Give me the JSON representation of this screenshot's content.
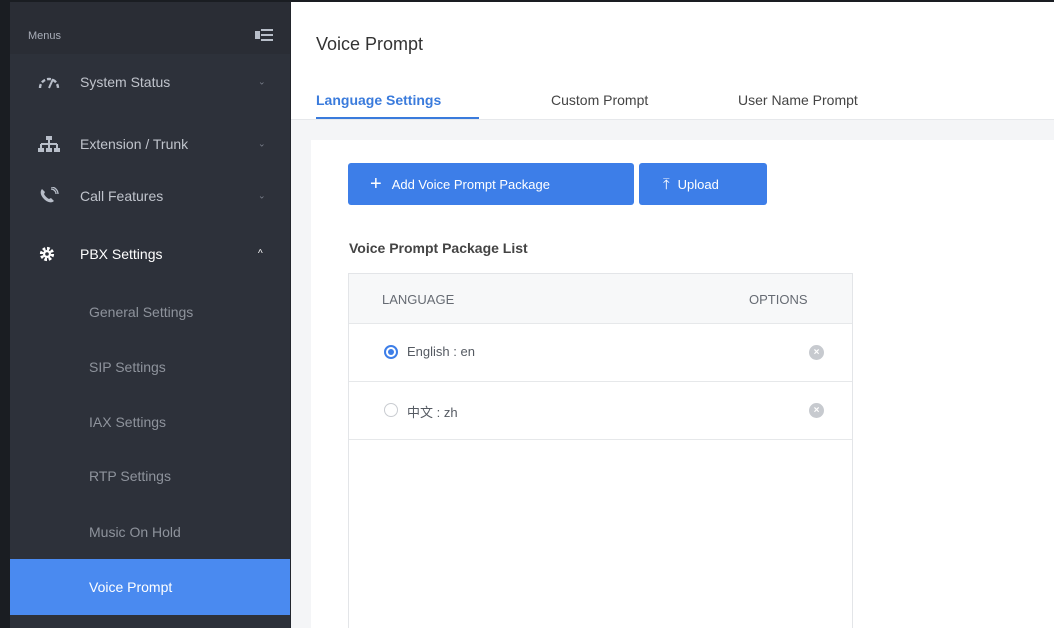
{
  "sidebar": {
    "menus_label": "Menus",
    "items": [
      {
        "label": "System Status",
        "icon": "gauge-icon",
        "chevron": "⌄"
      },
      {
        "label": "Extension / Trunk",
        "icon": "network-icon",
        "chevron": "⌄"
      },
      {
        "label": "Call Features",
        "icon": "phone-icon",
        "chevron": "⌄"
      },
      {
        "label": "PBX Settings",
        "icon": "gear-icon",
        "chevron": "^"
      }
    ],
    "subitems": [
      {
        "label": "General Settings"
      },
      {
        "label": "SIP Settings"
      },
      {
        "label": "IAX Settings"
      },
      {
        "label": "RTP Settings"
      },
      {
        "label": "Music On Hold"
      },
      {
        "label": "Voice Prompt"
      }
    ]
  },
  "header": {
    "title": "Voice Prompt",
    "tabs": [
      {
        "label": "Language Settings"
      },
      {
        "label": "Custom Prompt"
      },
      {
        "label": "User Name Prompt"
      }
    ]
  },
  "toolbar": {
    "add_label": "Add Voice Prompt Package",
    "add_icon": "+",
    "upload_label": "Upload",
    "upload_icon": "⤒"
  },
  "list": {
    "title": "Voice Prompt Package List",
    "columns": [
      "LANGUAGE",
      "OPTIONS"
    ],
    "rows": [
      {
        "language": "English : en",
        "selected": true
      },
      {
        "language": "中文 : zh",
        "selected": false
      }
    ],
    "delete_icon": "×"
  },
  "colors": {
    "accent": "#3d7ee8",
    "sidebar_bg": "#2d313a",
    "active_item_bg": "#4a8af0"
  }
}
